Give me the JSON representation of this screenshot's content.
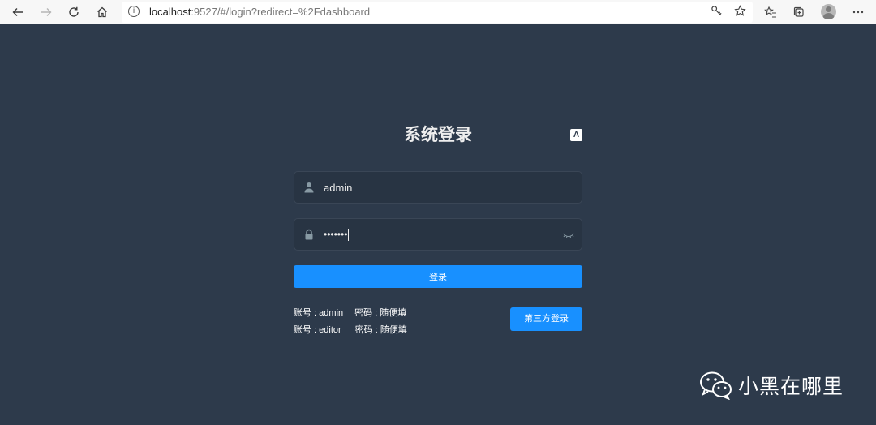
{
  "browser": {
    "back_icon": "arrow-left-icon",
    "forward_icon": "arrow-right-icon",
    "refresh_icon": "refresh-icon",
    "home_icon": "home-icon",
    "url_host": "localhost",
    "url_rest": ":9527/#/login?redirect=%2Fdashboard"
  },
  "login": {
    "title": "系统登录",
    "lang_icon": "A",
    "username": "admin",
    "password_masked": "•••••••",
    "login_label": "登录",
    "third_party_label": "第三方登录",
    "tips": [
      {
        "account": "账号 : admin",
        "password": "密码 : 随便填"
      },
      {
        "account": "账号 : editor",
        "password": "密码 : 随便填"
      }
    ]
  },
  "watermark": {
    "text": "小黑在哪里"
  },
  "colors": {
    "page_bg": "#2d3a4b",
    "input_bg": "#283443",
    "primary": "#1890ff",
    "title": "#eeeeee"
  }
}
